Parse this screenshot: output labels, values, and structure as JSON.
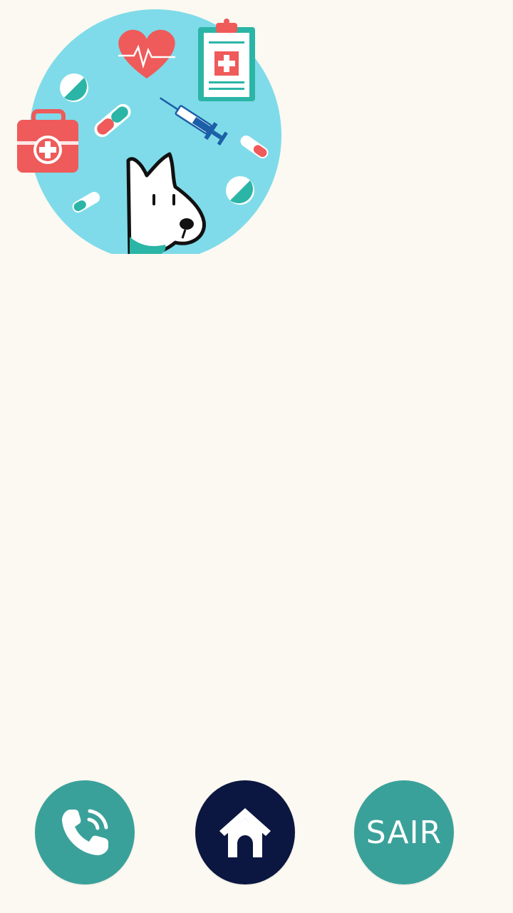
{
  "colors": {
    "background": "#fbf9f1",
    "teal": "#3aa19a",
    "navy": "#0b1740",
    "hero_circle": "#7fdbe9",
    "medical_red": "#ef5a5a"
  },
  "hero": {
    "icon": "vet-medical-illustration-icon",
    "elements": [
      "heart-rate-icon",
      "clipboard-icon",
      "first-aid-kit-icon",
      "pill-icon",
      "capsule-icon",
      "syringe-icon",
      "dog-icon"
    ]
  },
  "bottom_nav": {
    "call": {
      "icon": "phone-icon"
    },
    "home": {
      "icon": "dog-house-icon"
    },
    "exit": {
      "label": "SAIR"
    }
  }
}
